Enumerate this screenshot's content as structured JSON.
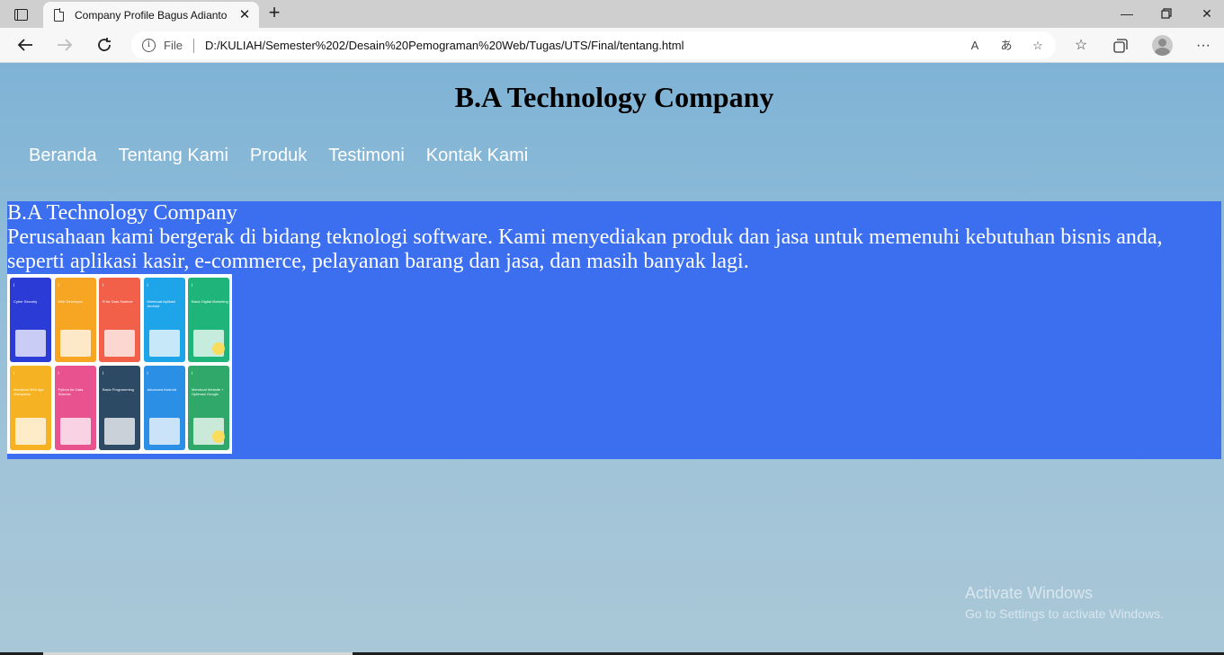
{
  "browser": {
    "tab_title": "Company Profile Bagus Adianto",
    "tab_close": "✕",
    "new_tab": "+",
    "file_label": "File",
    "url": "D:/KULIAH/Semester%202/Desain%20Pemograman%20Web/Tugas/UTS/Final/tentang.html",
    "read_aloud": "A",
    "translate": "あ"
  },
  "page": {
    "site_title": "B.A Technology Company",
    "menu": [
      {
        "label": "Beranda"
      },
      {
        "label": "Tentang Kami"
      },
      {
        "label": "Produk"
      },
      {
        "label": "Testimoni"
      },
      {
        "label": "Kontak Kami"
      }
    ],
    "section_heading": "B.A Technology Company",
    "section_text": "Perusahaan kami bergerak di bidang teknologi software. Kami menyediakan produk dan jasa untuk memenuhi kebutuhan bisnis anda, seperti aplikasi kasir, e-commerce, pelayanan barang dan jasa, dan masih banyak lagi.",
    "product_cards": [
      {
        "title": "Cyber Security",
        "color": "#2a3bd6"
      },
      {
        "title": "Web Developer",
        "color": "#f6a623"
      },
      {
        "title": "R for Data Science",
        "color": "#f2604a"
      },
      {
        "title": "Membuat Aplikasi Android",
        "color": "#1ea4e8"
      },
      {
        "title": "Basic Digital Marketing",
        "color": "#1fb57a"
      },
      {
        "title": "Membuat Web dgn Wordpress",
        "color": "#f5b323"
      },
      {
        "title": "Python for Data Science",
        "color": "#e8528f"
      },
      {
        "title": "Basic Programming",
        "color": "#2c4a63"
      },
      {
        "title": "Advanced Android",
        "color": "#2c8fe6"
      },
      {
        "title": "Membuat Website + Optimasi Google",
        "color": "#2fa86a"
      }
    ]
  },
  "watermark": {
    "line1": "Activate Windows",
    "line2": "Go to Settings to activate Windows."
  },
  "colors": {
    "content_bg": "#3b6ff0",
    "menu_text": "#ffffff"
  }
}
